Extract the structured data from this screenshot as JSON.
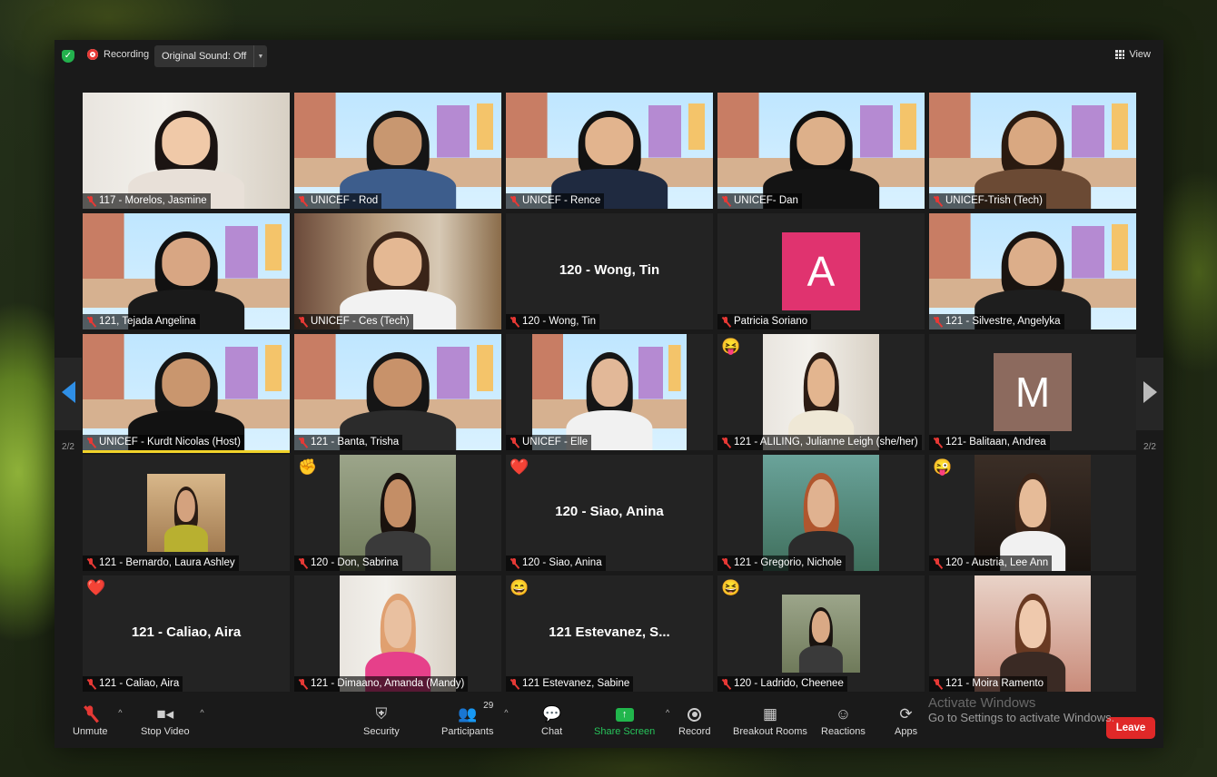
{
  "top": {
    "recording_label": "Recording",
    "sound_label": "Original Sound: Off",
    "view_label": "View"
  },
  "tiles": [
    {
      "name": "117 - Morelos, Jasmine",
      "type": "video",
      "scene": "room",
      "skin": "#f0c9a8",
      "hair": "#1b1412",
      "shirt": "#e8e0d8"
    },
    {
      "name": "UNICEF - Rod",
      "type": "video",
      "scene": "vbg",
      "skin": "#c89770",
      "hair": "#151515",
      "shirt": "#3d5d8c"
    },
    {
      "name": "UNICEF - Rence",
      "type": "video",
      "scene": "vbg",
      "skin": "#e2b48e",
      "hair": "#121212",
      "shirt": "#1f2a40"
    },
    {
      "name": "UNICEF- Dan",
      "type": "video",
      "scene": "vbg",
      "skin": "#ddb08a",
      "hair": "#0f0f0f",
      "shirt": "#141414"
    },
    {
      "name": "UNICEF-Trish (Tech)",
      "type": "video",
      "scene": "vbg",
      "skin": "#d9a881",
      "hair": "#2a1a10",
      "shirt": "#6b4a34"
    },
    {
      "name": "121, Tejada Angelina",
      "type": "video",
      "scene": "vbg",
      "skin": "#d8a683",
      "hair": "#111",
      "shirt": "#1a1a1a"
    },
    {
      "name": "UNICEF - Ces (Tech)",
      "type": "video",
      "scene": "room2",
      "skin": "#e4b893",
      "hair": "#3a2418",
      "shirt": "#f2f2f2"
    },
    {
      "name": "120 - Wong, Tin",
      "type": "name",
      "center": "120 - Wong, Tin"
    },
    {
      "name": "Patricia Soriano",
      "type": "avatar",
      "letter": "A",
      "color": "#e0336f"
    },
    {
      "name": "121 - Silvestre, Angelyka",
      "type": "video",
      "scene": "vbg",
      "skin": "#dcae8a",
      "hair": "#1a1410",
      "shirt": "#1e1e1e"
    },
    {
      "name": "UNICEF - Kurdt Nicolas (Host)",
      "type": "video",
      "scene": "vbg",
      "skin": "#c9966e",
      "hair": "#151515",
      "shirt": "#121212",
      "active": true
    },
    {
      "name": "121 - Banta, Trisha",
      "type": "video",
      "scene": "vbg",
      "skin": "#c8926a",
      "hair": "#151515",
      "shirt": "#2b2b2b"
    },
    {
      "name": "UNICEF - Elle",
      "type": "video",
      "scene": "vbg",
      "crop": "c170",
      "skin": "#e2b898",
      "hair": "#161616",
      "shirt": "#f1f1f1"
    },
    {
      "name": "121 - ALILING, Julianne Leigh (she/her)",
      "type": "video",
      "scene": "room",
      "crop": "c128",
      "skin": "#e3b58f",
      "hair": "#2c1c14",
      "shirt": "#efe8d6",
      "reaction": "😝"
    },
    {
      "name": "121- Balitaan, Andrea",
      "type": "avatar",
      "letter": "M",
      "color": "#8c6a5e"
    },
    {
      "name": "121 - Bernardo, Laura Ashley",
      "type": "video",
      "scene": "warm",
      "crop": "c86",
      "skin": "#d4a27e",
      "hair": "#2a1c14",
      "shirt": "#b8b030"
    },
    {
      "name": "120 - Don, Sabrina",
      "type": "video",
      "scene": "out",
      "crop": "c128",
      "skin": "#c48e66",
      "hair": "#1a120e",
      "shirt": "#3a3a3a",
      "reaction": "✊"
    },
    {
      "name": "120 - Siao, Anina",
      "type": "name",
      "center": "120 - Siao, Anina",
      "reaction": "❤️"
    },
    {
      "name": "121 - Gregorio, Nichole",
      "type": "video",
      "scene": "tree",
      "crop": "c128",
      "skin": "#e0b290",
      "hair": "#b0562e",
      "shirt": "#2b2b2b"
    },
    {
      "name": "120 - Austria, Lee Ann",
      "type": "video",
      "scene": "dark",
      "crop": "c128",
      "skin": "#e6bb98",
      "hair": "#3a2418",
      "shirt": "#f1f1f1",
      "reaction": "😜"
    },
    {
      "name": "121 - Caliao, Aira",
      "type": "name",
      "center": "121 - Caliao, Aira",
      "reaction": "❤️"
    },
    {
      "name": "121 - Dimaano, Amanda (Mandy)",
      "type": "video",
      "scene": "room",
      "crop": "c128",
      "skin": "#e9c0a0",
      "hair": "#e0a070",
      "shirt": "#e6408a"
    },
    {
      "name": "121 Estevanez, Sabine",
      "type": "name",
      "center": "121 Estevanez, S...",
      "reaction": "😄"
    },
    {
      "name": "120 - Ladrido, Cheenee",
      "type": "video",
      "scene": "out",
      "crop": "c86",
      "skin": "#d9a985",
      "hair": "#1a1410",
      "shirt": "#3a3a3a",
      "reaction": "😆"
    },
    {
      "name": "121 - Moira Ramento",
      "type": "video",
      "scene": "pink",
      "crop": "c128",
      "skin": "#efc9ad",
      "hair": "#6a3a22",
      "shirt": "#3a2a24"
    }
  ],
  "paging": {
    "left": "2/2",
    "right": "2/2"
  },
  "toolbar": {
    "unmute": "Unmute",
    "stop_video": "Stop Video",
    "security": "Security",
    "participants": "Participants",
    "participants_count": "29",
    "chat": "Chat",
    "share_screen": "Share Screen",
    "record": "Record",
    "breakout_rooms": "Breakout Rooms",
    "reactions": "Reactions",
    "apps": "Apps",
    "leave": "Leave"
  },
  "watermark": {
    "line1": "Activate Windows",
    "line2": "Go to Settings to activate Windows."
  },
  "colors": {
    "share_green": "#21b64c",
    "leave_red": "#e02828",
    "active_speaker": "#f1d32a"
  }
}
